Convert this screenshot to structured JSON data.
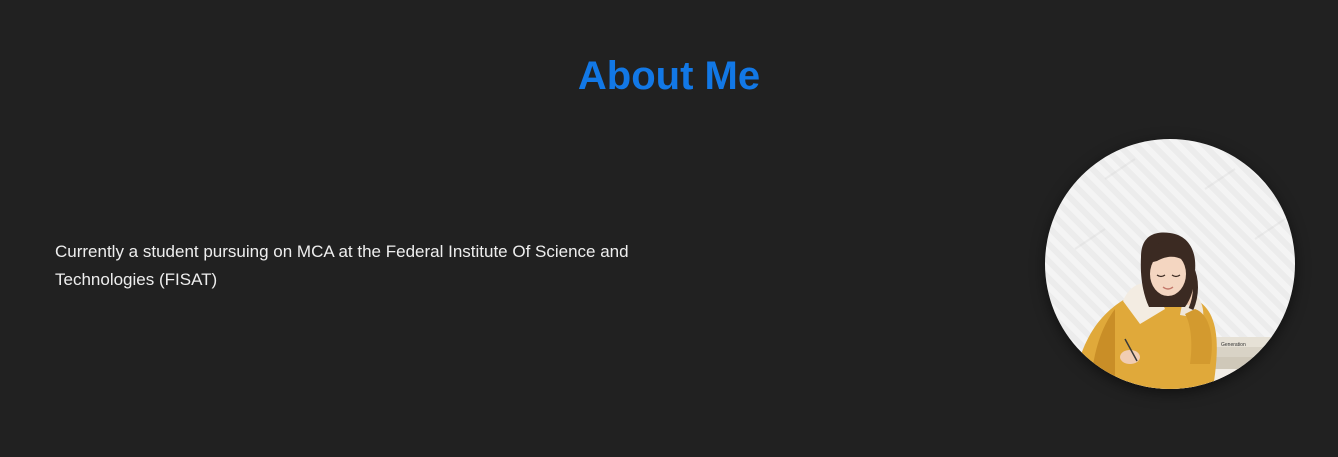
{
  "about": {
    "title": "About Me",
    "description": "Currently a student pursuing on MCA at the Federal Institute Of Science and Technologies (FISAT)"
  },
  "profile_photo": {
    "book_label": "Generation"
  },
  "colors": {
    "background": "#212121",
    "title": "#1278e6",
    "text": "#eeeeee"
  }
}
